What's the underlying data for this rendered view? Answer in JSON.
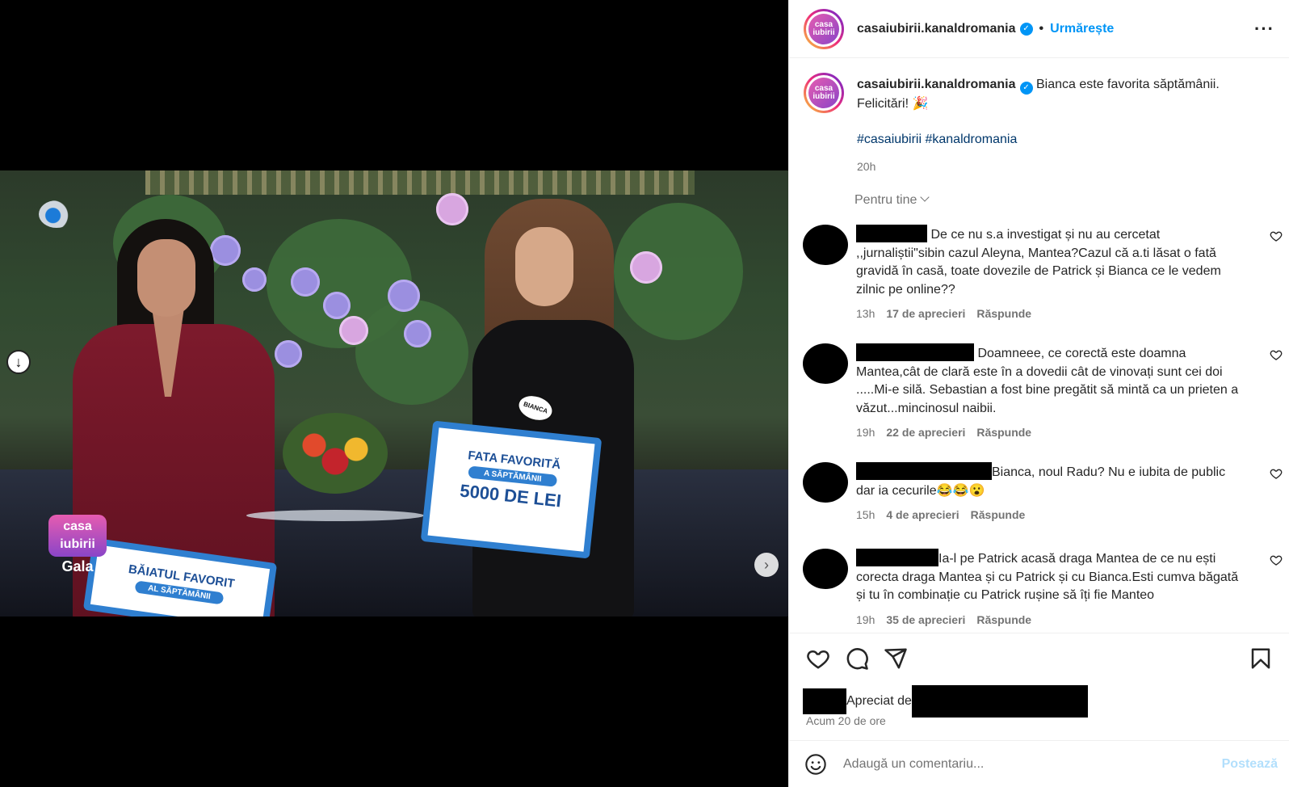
{
  "post": {
    "username": "casaiubirii.kanaldromania",
    "follow_label": "Urmărește",
    "separator": "•",
    "avatar_text": "casa iubirii",
    "caption_line1": "Bianca este favorita săptămânii.",
    "caption_line2": "Felicitări! 🎉",
    "hashtags": "#casaiubirii #kanaldromania",
    "time": "20h",
    "sort_label": "Pentru tine"
  },
  "media": {
    "sign_title": "FATA FAVORITĂ",
    "sign_sub": "A SĂPTĂMÂNII",
    "sign_amount": "5000 DE LEI",
    "sign2_title": "BĂIATUL FAVORIT",
    "sign2_sub": "AL SĂPTĂMÂNII",
    "name_badge": "BIANCA",
    "show_logo": "casa iubirii",
    "show_logo_sub": "Gala",
    "slide_index": 1,
    "slide_count": 3
  },
  "comments": [
    {
      "text": "De ce nu s.a investigat și nu au cercetat ,,jurnaliștii\"sibin cazul Aleyna, Mantea?Cazul că a.ti lăsat o fată gravidă în casă, toate dovezile de Patrick și Bianca ce le vedem zilnic pe online??",
      "time": "13h",
      "likes": "17 de aprecieri",
      "reply": "Răspunde"
    },
    {
      "text": "Doamneee, ce corectă este doamna Mantea,cât de clară este în a dovedii cât de vinovați sunt cei doi .....Mi-e silă. Sebastian a fost bine pregătit să mintă ca un prieten a văzut...mincinosul naibii.",
      "time": "19h",
      "likes": "22 de aprecieri",
      "reply": "Răspunde"
    },
    {
      "text": "Bianca, noul Radu? Nu e iubita de public dar ia cecurile😂😂😮",
      "time": "15h",
      "likes": "4 de aprecieri",
      "reply": "Răspunde"
    },
    {
      "text": "Ia-l pe Patrick acasă draga Mantea de ce nu ești corecta draga Mantea și cu Patrick și cu Bianca.Esti cumva băgată și tu în combinație cu Patrick rușine să îți fie Manteo",
      "time": "19h",
      "likes": "35 de aprecieri",
      "reply": "Răspunde"
    }
  ],
  "footer": {
    "liked_by": "Apreciat de",
    "ago": "Acum 20 de ore",
    "comment_placeholder": "Adaugă un comentariu...",
    "post_label": "Postează"
  },
  "colors": {
    "accent": "#0095f6",
    "text": "#262626",
    "muted": "#737373",
    "hashtag": "#00376b"
  }
}
